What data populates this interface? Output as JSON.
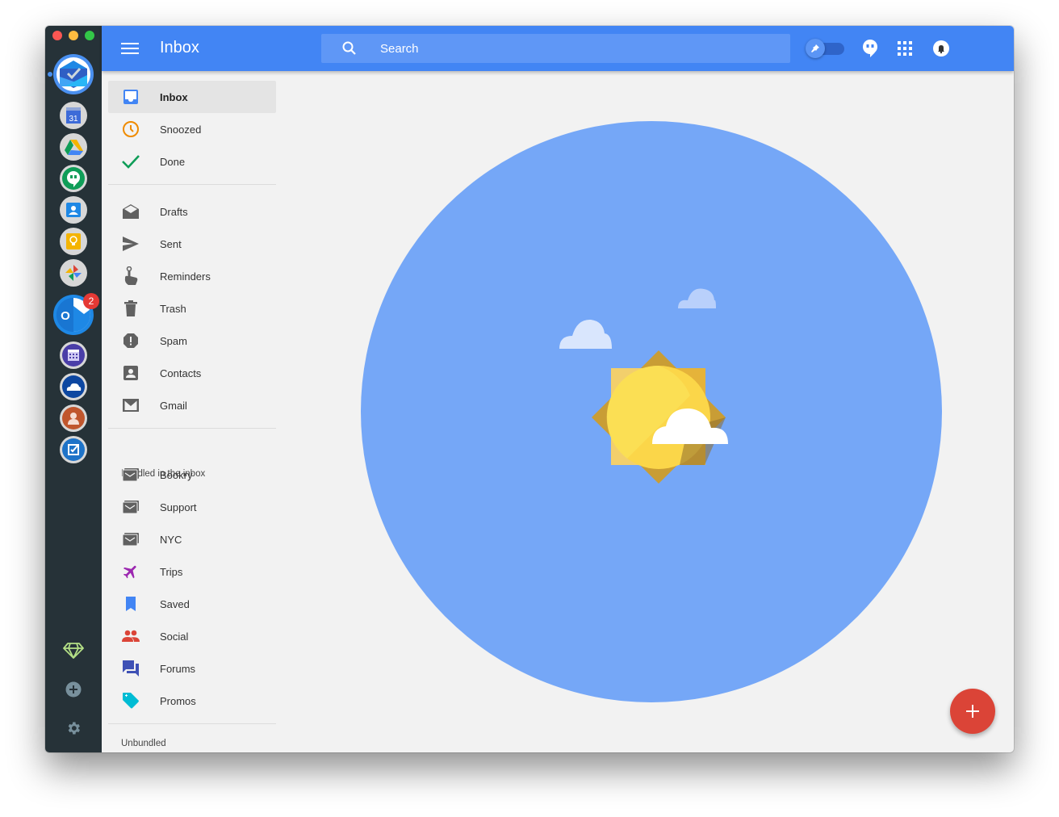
{
  "window": {
    "traffic_lights": [
      "close",
      "minimize",
      "maximize"
    ]
  },
  "dock": {
    "apps": [
      {
        "name": "Inbox",
        "icon": "inbox-app-icon",
        "active": true
      },
      {
        "name": "Calendar",
        "icon": "calendar-app-icon",
        "label": "31"
      },
      {
        "name": "Drive",
        "icon": "drive-app-icon"
      },
      {
        "name": "Hangouts",
        "icon": "hangouts-app-icon"
      },
      {
        "name": "Contacts",
        "icon": "contacts-app-icon"
      },
      {
        "name": "Keep",
        "icon": "keep-app-icon"
      },
      {
        "name": "Photos",
        "icon": "photos-app-icon"
      },
      {
        "name": "Outlook",
        "icon": "outlook-app-icon",
        "badge": "2",
        "letter": "O"
      },
      {
        "name": "Outlook Calendar",
        "icon": "outlook-calendar-app-icon"
      },
      {
        "name": "OneDrive",
        "icon": "onedrive-app-icon"
      },
      {
        "name": "Outlook People",
        "icon": "people-app-icon"
      },
      {
        "name": "Outlook Tasks",
        "icon": "tasks-app-icon"
      }
    ],
    "utilities": [
      "premium-diamond-icon",
      "add-service-icon",
      "settings-gear-icon"
    ]
  },
  "header": {
    "title": "Inbox",
    "search_placeholder": "Search",
    "pin_toggle": "off",
    "icons": [
      "hangouts-icon",
      "apps-grid-icon",
      "notifications-bell-icon"
    ]
  },
  "nav": {
    "primary": [
      {
        "label": "Inbox",
        "icon": "inbox-icon",
        "selected": true
      },
      {
        "label": "Snoozed",
        "icon": "clock-icon"
      },
      {
        "label": "Done",
        "icon": "check-icon"
      }
    ],
    "secondary": [
      {
        "label": "Drafts",
        "icon": "drafts-icon"
      },
      {
        "label": "Sent",
        "icon": "send-icon"
      },
      {
        "label": "Reminders",
        "icon": "reminder-finger-icon"
      },
      {
        "label": "Trash",
        "icon": "trash-icon"
      },
      {
        "label": "Spam",
        "icon": "spam-icon"
      },
      {
        "label": "Contacts",
        "icon": "contacts-icon"
      },
      {
        "label": "Gmail",
        "icon": "gmail-icon"
      }
    ],
    "bundled_header": "Bundled in the inbox",
    "bundles": [
      {
        "label": "Bookry",
        "icon": "label-stack-icon"
      },
      {
        "label": "Support",
        "icon": "label-stack-icon"
      },
      {
        "label": "NYC",
        "icon": "label-stack-icon"
      },
      {
        "label": "Trips",
        "icon": "airplane-icon"
      },
      {
        "label": "Saved",
        "icon": "bookmark-icon"
      },
      {
        "label": "Social",
        "icon": "people-icon"
      },
      {
        "label": "Forums",
        "icon": "forum-icon"
      },
      {
        "label": "Promos",
        "icon": "tag-icon"
      }
    ],
    "unbundled_header": "Unbundled"
  },
  "colors": {
    "header_blue": "#4285f4",
    "dock_bg": "#263238",
    "sky": "#75a7f7",
    "fab_red": "#db4437",
    "snoozed_orange": "#ef8b00",
    "done_green": "#0f9d58",
    "trips_purple": "#9c27b0",
    "saved_blue": "#4285f4",
    "social_red": "#db4437",
    "forums_indigo": "#3f51b5",
    "promos_cyan": "#00bcd4"
  },
  "main": {
    "empty_state": "inbox-zero-sunny-illustration",
    "fab_label": "+"
  }
}
